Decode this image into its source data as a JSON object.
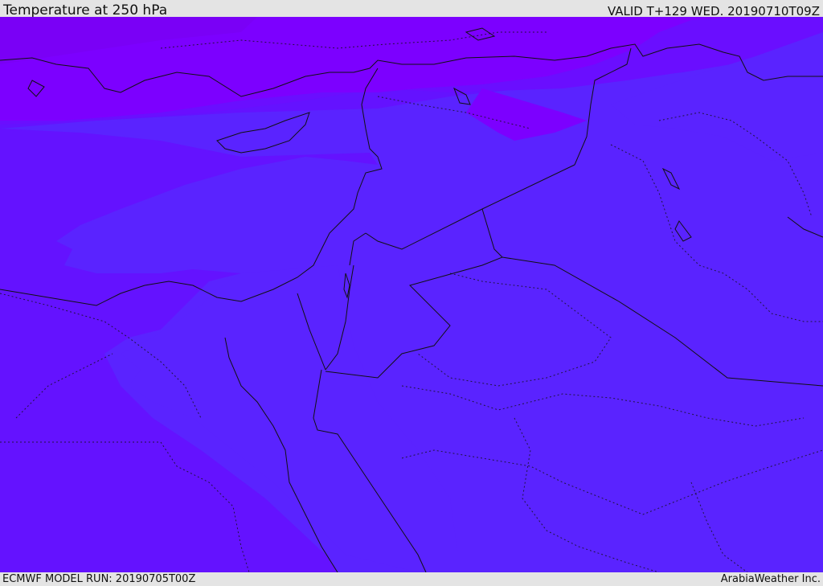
{
  "header": {
    "title": "Temperature at 250 hPa",
    "valid": "VALID T+129 WED. 20190710T09Z"
  },
  "footer": {
    "model_run": "ECMWF MODEL RUN: 20190705T00Z",
    "credit": "ArabiaWeather Inc."
  },
  "map": {
    "variable": "temperature",
    "level": "250 hPa",
    "colors": {
      "coldest": "#7c00ff",
      "cold": "#6a08ff",
      "mid": "#6012ff",
      "warm": "#5a23ff",
      "border": "#111111"
    }
  }
}
